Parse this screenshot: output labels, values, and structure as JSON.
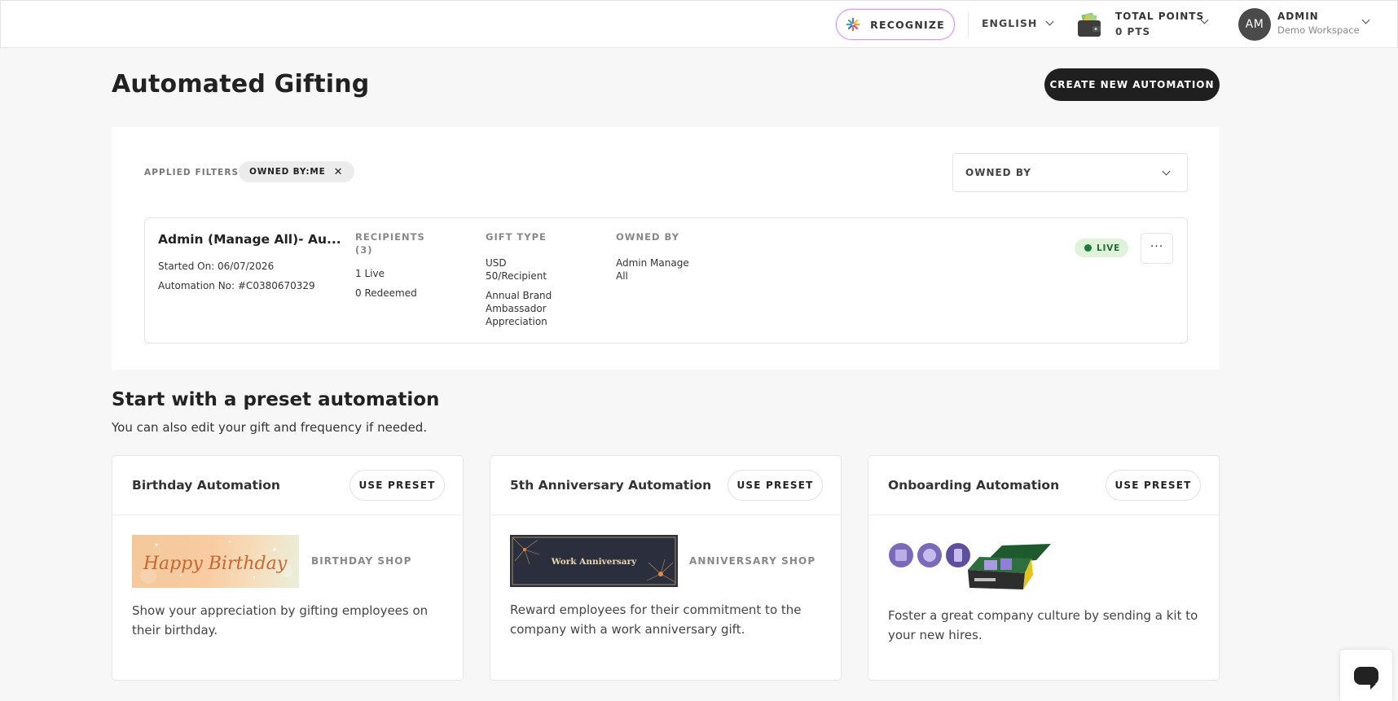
{
  "header": {
    "recognize_label": "RECOGNIZE",
    "language": "ENGLISH",
    "points_label": "TOTAL POINTS",
    "points_value": "0 PTS",
    "user_initials": "AM",
    "user_name": "ADMIN",
    "workspace": "Demo Workspace"
  },
  "page": {
    "title": "Automated Gifting",
    "create_button": "CREATE NEW AUTOMATION"
  },
  "filters": {
    "applied_label": "APPLIED FILTERS:",
    "chip": "OWNED BY:ME",
    "owned_by_select": "OWNED BY"
  },
  "automation": {
    "name": "Admin (Manage All)- Au...",
    "started": "Started On: 06/07/2026",
    "number": "Automation No: #C0380670329",
    "recipients_header": "RECIPIENTS",
    "recipients_count": "(3)",
    "live_count": "1 Live",
    "redeemed_count": "0 Redeemed",
    "gift_header": "GIFT TYPE",
    "gift_amount_1": "USD",
    "gift_amount_2": "50/Recipient",
    "gift_name_1": "Annual Brand",
    "gift_name_2": "Ambassador",
    "gift_name_3": "Appreciation",
    "owner_header": "OWNED BY",
    "owner_1": "Admin Manage",
    "owner_2": "All",
    "status": "LIVE",
    "more": "···"
  },
  "presets": {
    "heading": "Start with a preset automation",
    "subheading": "You can also edit your gift and frequency if needed.",
    "use_preset_label": "USE PRESET",
    "cards": [
      {
        "title": "Birthday Automation",
        "shop": "BIRTHDAY SHOP",
        "image_text": "Happy Birthday",
        "description": "Show your appreciation by gifting employees on their birthday."
      },
      {
        "title": "5th Anniversary Automation",
        "shop": "ANNIVERSARY SHOP",
        "image_text": "Work Anniversary",
        "description": "Reward employees for their commitment to the company with a work anniversary gift."
      },
      {
        "title": "Onboarding Automation",
        "description": "Foster a great company culture by sending a kit to your new hires."
      }
    ]
  },
  "colors": {
    "accent_dark": "#1f1f1f",
    "live_bg": "#def3da",
    "live_text": "#256a33",
    "recognize_border": "#d79be8"
  }
}
